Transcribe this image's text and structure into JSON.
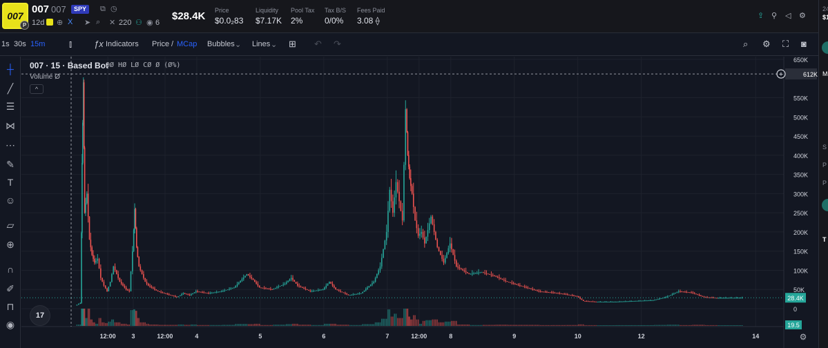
{
  "header": {
    "logo_text": "007",
    "logo_badge": "P",
    "ticker": "007",
    "ticker_sub": "007",
    "chain_badge": "SPY",
    "age": "12d",
    "followers": "220",
    "views": "6",
    "price_usd": "$28.4K",
    "stats": [
      {
        "label": "Price",
        "value": "$0.0₂83"
      },
      {
        "label": "Liquidity",
        "value": "$7.17K"
      },
      {
        "label": "Pool Tax",
        "value": "2%"
      },
      {
        "label": "Tax B/S",
        "value": "0/0%"
      },
      {
        "label": "Fees Paid",
        "value": "3.08 ⟠"
      }
    ],
    "accent": "#26a69a"
  },
  "toolbar": {
    "intervals": [
      "1s",
      "30s",
      "15m"
    ],
    "active_interval": "15m",
    "indicators_label": "Indicators",
    "price_label": "Price",
    "separator": "/",
    "mcap_label": "MCap",
    "bubbles_label": "Bubbles",
    "lines_label": "Lines"
  },
  "legend": {
    "title": "007 · 15 · Based Bot",
    "ohlc": "OØ HØ LØ CØ Ø (Ø%)",
    "volume": "Volume  Ø",
    "collapse": "^",
    "tv_logo": "17"
  },
  "right_panel": {
    "top_text": "24",
    "price_short": "$1",
    "tab": "M",
    "labels": [
      "S",
      "P",
      "P",
      "T"
    ]
  },
  "colors": {
    "background": "#131722",
    "up": "#26a69a",
    "down": "#ef5350",
    "last_price_tag": "#26a69a",
    "crosshair_tag": "#2a2e39"
  },
  "chart_data": {
    "type": "candlestick",
    "y_unit": "market cap (USD)",
    "ylim": [
      0,
      650000
    ],
    "y_ticks": [
      "650K",
      "550K",
      "500K",
      "450K",
      "400K",
      "350K",
      "300K",
      "250K",
      "200K",
      "150K",
      "100K",
      "50K",
      "0"
    ],
    "y_tick_values": [
      650000,
      550000,
      500000,
      450000,
      400000,
      350000,
      300000,
      250000,
      200000,
      150000,
      100000,
      50000,
      0
    ],
    "x_ticks": [
      "12:00",
      "3",
      "12:00",
      "4",
      "5",
      "6",
      "7",
      "12:00",
      "8",
      "9",
      "10",
      "12",
      "14"
    ],
    "x_tick_positions": [
      0.6,
      1.0,
      1.5,
      2.0,
      3.0,
      4.0,
      5.0,
      5.5,
      6.0,
      7.0,
      8.0,
      9.0,
      10.8
    ],
    "x_range": [
      0,
      11.2
    ],
    "crosshair_value": 612000,
    "crosshair_label": "612K",
    "crosshair_x": 0.0,
    "last_value": 28400,
    "last_label": "28.4K",
    "volume_label": "19.5",
    "series": [
      {
        "x": 0.1,
        "v": 8000
      },
      {
        "x": 0.18,
        "v": 15000
      },
      {
        "x": 0.2,
        "v": 380000
      },
      {
        "x": 0.22,
        "v": 590000
      },
      {
        "x": 0.24,
        "v": 250000
      },
      {
        "x": 0.28,
        "v": 300000
      },
      {
        "x": 0.32,
        "v": 180000
      },
      {
        "x": 0.36,
        "v": 140000
      },
      {
        "x": 0.4,
        "v": 120000
      },
      {
        "x": 0.45,
        "v": 130000
      },
      {
        "x": 0.5,
        "v": 80000
      },
      {
        "x": 0.55,
        "v": 60000
      },
      {
        "x": 0.6,
        "v": 45000
      },
      {
        "x": 0.65,
        "v": 70000
      },
      {
        "x": 0.7,
        "v": 110000
      },
      {
        "x": 0.75,
        "v": 90000
      },
      {
        "x": 0.8,
        "v": 70000
      },
      {
        "x": 0.85,
        "v": 60000
      },
      {
        "x": 0.9,
        "v": 50000
      },
      {
        "x": 0.95,
        "v": 45000
      },
      {
        "x": 1.0,
        "v": 150000
      },
      {
        "x": 1.03,
        "v": 260000
      },
      {
        "x": 1.06,
        "v": 160000
      },
      {
        "x": 1.1,
        "v": 110000
      },
      {
        "x": 1.15,
        "v": 90000
      },
      {
        "x": 1.2,
        "v": 70000
      },
      {
        "x": 1.25,
        "v": 60000
      },
      {
        "x": 1.3,
        "v": 55000
      },
      {
        "x": 1.4,
        "v": 45000
      },
      {
        "x": 1.5,
        "v": 40000
      },
      {
        "x": 1.6,
        "v": 35000
      },
      {
        "x": 1.7,
        "v": 30000
      },
      {
        "x": 1.8,
        "v": 40000
      },
      {
        "x": 1.9,
        "v": 35000
      },
      {
        "x": 2.0,
        "v": 45000
      },
      {
        "x": 2.2,
        "v": 40000
      },
      {
        "x": 2.4,
        "v": 45000
      },
      {
        "x": 2.6,
        "v": 55000
      },
      {
        "x": 2.8,
        "v": 90000
      },
      {
        "x": 2.9,
        "v": 75000
      },
      {
        "x": 3.0,
        "v": 55000
      },
      {
        "x": 3.2,
        "v": 50000
      },
      {
        "x": 3.4,
        "v": 65000
      },
      {
        "x": 3.5,
        "v": 80000
      },
      {
        "x": 3.6,
        "v": 60000
      },
      {
        "x": 3.8,
        "v": 45000
      },
      {
        "x": 4.0,
        "v": 50000
      },
      {
        "x": 4.1,
        "v": 70000
      },
      {
        "x": 4.2,
        "v": 50000
      },
      {
        "x": 4.4,
        "v": 35000
      },
      {
        "x": 4.6,
        "v": 40000
      },
      {
        "x": 4.8,
        "v": 70000
      },
      {
        "x": 4.9,
        "v": 110000
      },
      {
        "x": 5.0,
        "v": 200000
      },
      {
        "x": 5.05,
        "v": 310000
      },
      {
        "x": 5.1,
        "v": 250000
      },
      {
        "x": 5.15,
        "v": 330000
      },
      {
        "x": 5.2,
        "v": 280000
      },
      {
        "x": 5.25,
        "v": 230000
      },
      {
        "x": 5.3,
        "v": 520000
      },
      {
        "x": 5.33,
        "v": 400000
      },
      {
        "x": 5.36,
        "v": 340000
      },
      {
        "x": 5.4,
        "v": 300000
      },
      {
        "x": 5.45,
        "v": 230000
      },
      {
        "x": 5.5,
        "v": 190000
      },
      {
        "x": 5.55,
        "v": 200000
      },
      {
        "x": 5.6,
        "v": 170000
      },
      {
        "x": 5.7,
        "v": 240000
      },
      {
        "x": 5.75,
        "v": 200000
      },
      {
        "x": 5.8,
        "v": 160000
      },
      {
        "x": 5.9,
        "v": 120000
      },
      {
        "x": 6.0,
        "v": 170000
      },
      {
        "x": 6.05,
        "v": 140000
      },
      {
        "x": 6.1,
        "v": 110000
      },
      {
        "x": 6.2,
        "v": 100000
      },
      {
        "x": 6.3,
        "v": 90000
      },
      {
        "x": 6.5,
        "v": 95000
      },
      {
        "x": 6.7,
        "v": 85000
      },
      {
        "x": 6.9,
        "v": 70000
      },
      {
        "x": 7.0,
        "v": 65000
      },
      {
        "x": 7.2,
        "v": 55000
      },
      {
        "x": 7.4,
        "v": 45000
      },
      {
        "x": 7.6,
        "v": 42000
      },
      {
        "x": 7.8,
        "v": 38000
      },
      {
        "x": 8.0,
        "v": 32000
      },
      {
        "x": 8.1,
        "v": 20000
      },
      {
        "x": 8.3,
        "v": 18000
      },
      {
        "x": 8.6,
        "v": 18000
      },
      {
        "x": 8.9,
        "v": 20000
      },
      {
        "x": 9.2,
        "v": 22000
      },
      {
        "x": 9.4,
        "v": 30000
      },
      {
        "x": 9.6,
        "v": 45000
      },
      {
        "x": 9.8,
        "v": 42000
      },
      {
        "x": 10.0,
        "v": 30000
      },
      {
        "x": 10.2,
        "v": 28000
      },
      {
        "x": 10.6,
        "v": 28400
      }
    ]
  }
}
